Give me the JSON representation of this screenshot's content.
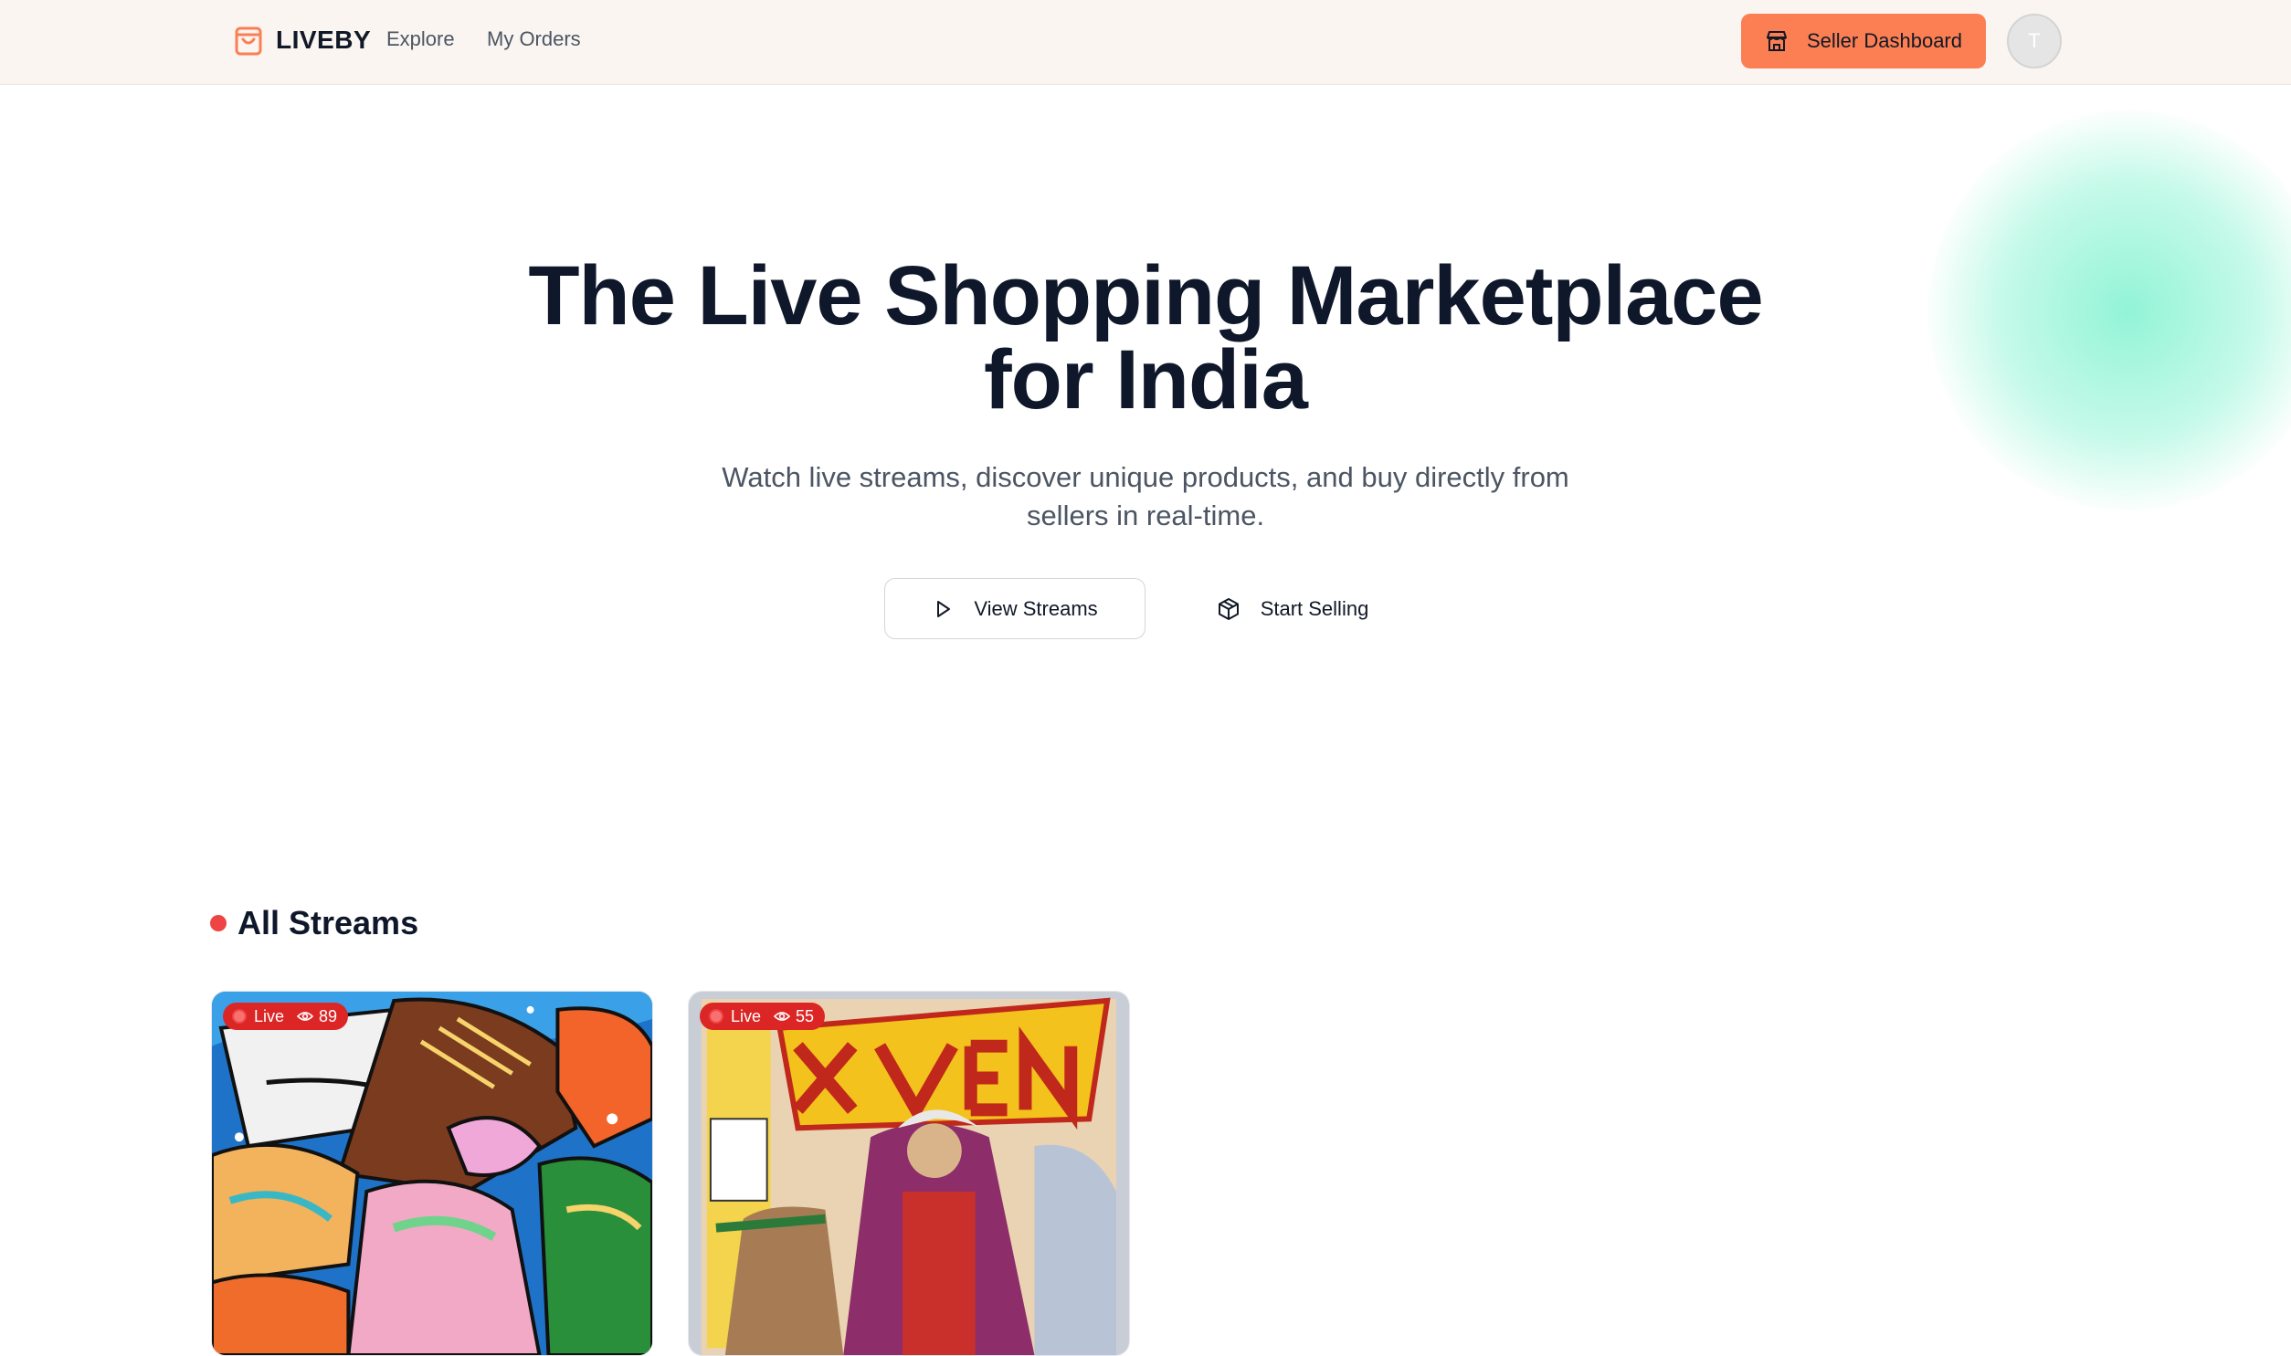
{
  "header": {
    "brand": "LIVEBY",
    "nav": {
      "explore": "Explore",
      "orders": "My Orders"
    },
    "seller_dashboard": "Seller Dashboard",
    "avatar_initial": "T"
  },
  "hero": {
    "title_line1": "The Live Shopping Marketplace",
    "title_line2": "for India",
    "subtitle_line1": "Watch live streams, discover unique products, and buy directly from",
    "subtitle_line2": "sellers in real-time.",
    "view_streams": "View Streams",
    "start_selling": "Start Selling"
  },
  "streams": {
    "title": "All Streams",
    "items": [
      {
        "status": "Live",
        "viewers": "89"
      },
      {
        "status": "Live",
        "viewers": "55"
      }
    ]
  },
  "icons": {
    "brand": "shopping-bag-icon",
    "seller": "store-icon",
    "view": "play-icon",
    "start": "package-icon",
    "viewers": "eye-icon"
  },
  "colors": {
    "accent": "#fb7f52",
    "header_bg": "#faf5f0",
    "live_red": "#dc2626",
    "glow": "#6ef0c8"
  }
}
